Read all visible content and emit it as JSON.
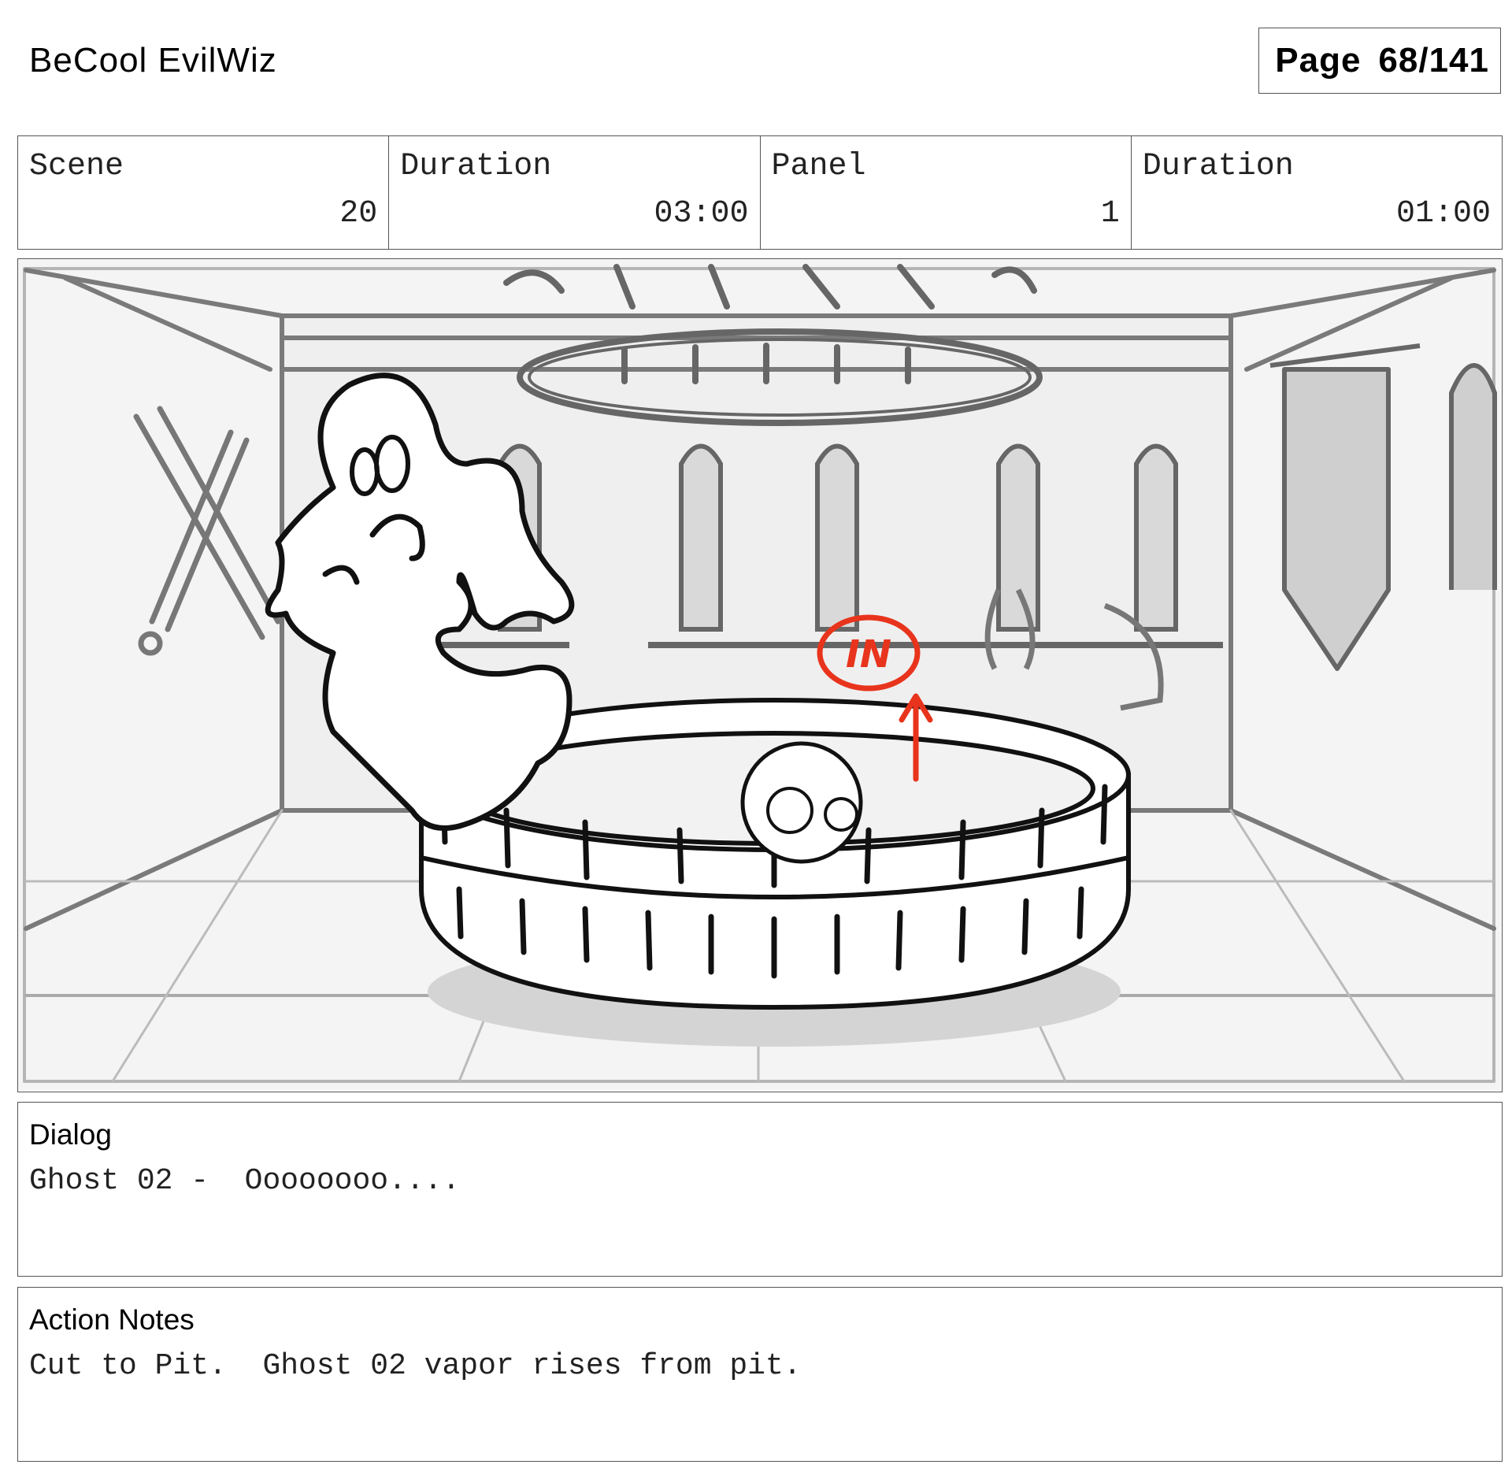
{
  "header": {
    "project_title": "BeCool EvilWiz",
    "page_label": "Page",
    "page_number": "68/141"
  },
  "info": {
    "scene_label": "Scene",
    "scene_value": "20",
    "scene_duration_label": "Duration",
    "scene_duration_value": "03:00",
    "panel_label": "Panel",
    "panel_value": "1",
    "panel_duration_label": "Duration",
    "panel_duration_value": "01:00"
  },
  "panel": {
    "annotation_text": "IN",
    "annotation_color": "#e8341c"
  },
  "dialog": {
    "heading": "Dialog",
    "text": "Ghost 02 -  Oooooooo...."
  },
  "action_notes": {
    "heading": "Action Notes",
    "text": "Cut to Pit.  Ghost 02 vapor rises from pit."
  }
}
